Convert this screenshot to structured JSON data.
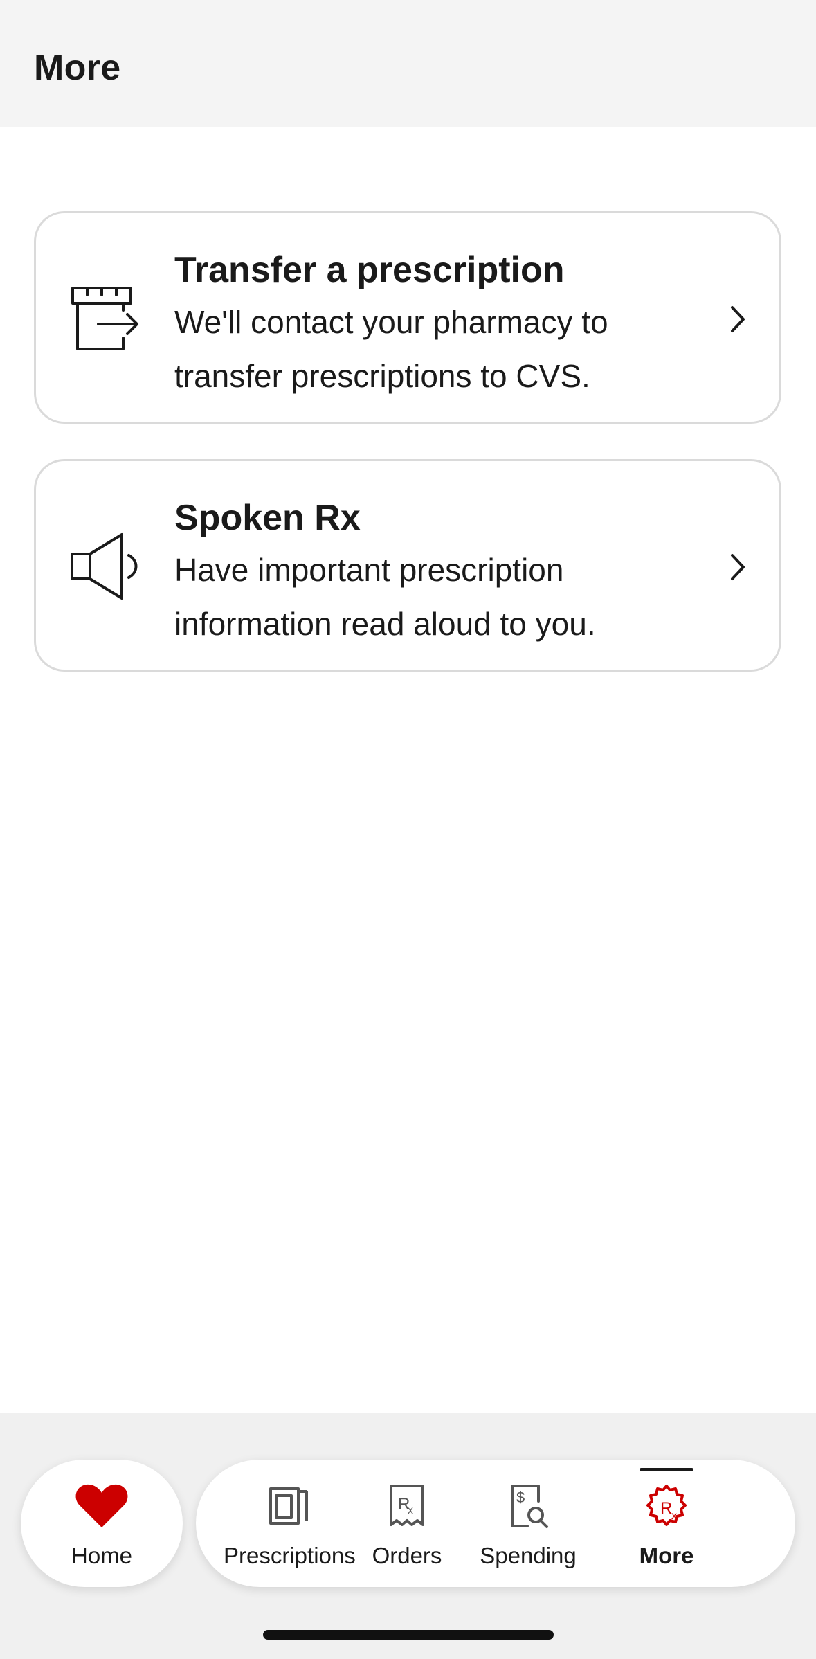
{
  "header": {
    "title": "More"
  },
  "cards": [
    {
      "title": "Transfer a prescription",
      "description": "We'll contact your pharmacy to transfer prescriptions to CVS.",
      "icon": "transfer-icon"
    },
    {
      "title": "Spoken Rx",
      "description": "Have important prescription information read aloud to you.",
      "icon": "speaker-icon"
    }
  ],
  "tabbar": {
    "home": {
      "label": "Home",
      "icon": "heart-icon"
    },
    "tabs": [
      {
        "label": "Prescriptions",
        "icon": "prescriptions-icon"
      },
      {
        "label": "Orders",
        "icon": "orders-icon"
      },
      {
        "label": "Spending",
        "icon": "spending-icon"
      },
      {
        "label": "More",
        "icon": "more-gear-rx-icon",
        "active": true
      }
    ]
  },
  "colors": {
    "brand_red": "#cc0000",
    "text": "#1a1a1a",
    "card_border": "#dadada",
    "header_bg": "#f4f4f4"
  }
}
